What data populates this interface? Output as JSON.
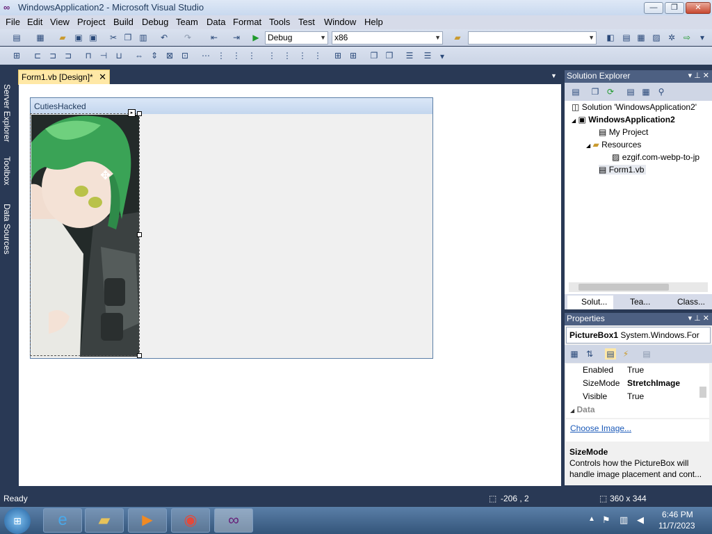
{
  "window": {
    "title": "WindowsApplication2 - Microsoft Visual Studio",
    "minimize": "—",
    "restore": "❐",
    "close": "✕"
  },
  "menu": [
    "File",
    "Edit",
    "View",
    "Project",
    "Build",
    "Debug",
    "Team",
    "Data",
    "Format",
    "Tools",
    "Test",
    "Window",
    "Help"
  ],
  "toolbar": {
    "config_value": "Debug",
    "platform_value": "x86",
    "find_value": ""
  },
  "left_rail": [
    "Server Explorer",
    "Toolbox",
    "Data Sources"
  ],
  "doc_tab": {
    "label": "Form1.vb [Design]*",
    "close": "✕"
  },
  "form": {
    "title": "CutiesHacked"
  },
  "solution_explorer": {
    "title": "Solution Explorer",
    "items": [
      {
        "label": "Solution 'WindowsApplication2'"
      },
      {
        "label": "WindowsApplication2"
      },
      {
        "label": "My Project"
      },
      {
        "label": "Resources"
      },
      {
        "label": "ezgif.com-webp-to-jp"
      },
      {
        "label": "Form1.vb"
      }
    ],
    "tabs": [
      "Solut...",
      "Tea...",
      "Class..."
    ]
  },
  "properties": {
    "title": "Properties",
    "object": "PictureBox1",
    "object_type": "System.Windows.For",
    "rows": [
      {
        "name": "Enabled",
        "value": "True"
      },
      {
        "name": "SizeMode",
        "value": "StretchImage"
      },
      {
        "name": "Visible",
        "value": "True"
      }
    ],
    "category": "Data",
    "link": "Choose Image...",
    "desc_title": "SizeMode",
    "desc_text": "Controls how the PictureBox will handle image placement and cont..."
  },
  "status": {
    "text": "Ready",
    "position": "-206 , 2",
    "size": "360 x 344"
  },
  "taskbar": {
    "time": "6:46 PM",
    "date": "11/7/2023"
  },
  "colors": {
    "chrome": "#293955",
    "tab_active": "#ffe8a6",
    "panel_head": "#4d6082"
  }
}
